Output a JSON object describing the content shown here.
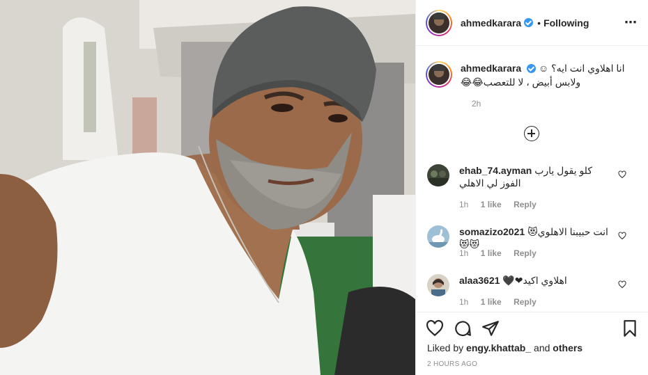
{
  "post": {
    "author": "ahmedkarara",
    "follow_separator": "•",
    "follow_status": "Following",
    "more_icon": "⋯"
  },
  "caption": {
    "username": "ahmedkarara",
    "line1": "انا اهلاوي انت ايه؟ ☺",
    "line2": "ولابس أبيض ، لا للتعصب😂😂",
    "time": "2h"
  },
  "comments": [
    {
      "username": "ehab_74.ayman",
      "text": "كلو يقول يارب الفوز لي الاهلي",
      "time": "1h",
      "likes": "1 like",
      "reply": "Reply"
    },
    {
      "username": "somazizo2021",
      "text": "انت حبيبنا الاهلوي😻😻😻",
      "time": "1h",
      "likes": "1 like",
      "reply": "Reply"
    },
    {
      "username": "alaa3621",
      "text": "اهلاوي اكيد❤🖤",
      "time": "1h",
      "likes": "1 like",
      "reply": "Reply"
    }
  ],
  "likes": {
    "prefix": "Liked by",
    "user": "engy.khattab_",
    "connector": "and",
    "others": "others"
  },
  "posted_time": "2 HOURS AGO",
  "colors": {
    "verified": "#3897f0",
    "meta": "#8e8e8e",
    "text": "#262626"
  }
}
